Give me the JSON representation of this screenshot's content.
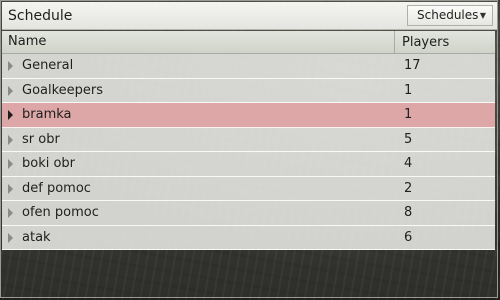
{
  "panel": {
    "title": "Schedule",
    "dropdown_label": "Schedules"
  },
  "table": {
    "columns": [
      "Name",
      "Players"
    ],
    "rows": [
      {
        "name": "General",
        "players": "17",
        "selected": false
      },
      {
        "name": "Goalkeepers",
        "players": "1",
        "selected": false
      },
      {
        "name": "bramka",
        "players": "1",
        "selected": true
      },
      {
        "name": "sr obr",
        "players": "5",
        "selected": false
      },
      {
        "name": "boki obr",
        "players": "4",
        "selected": false
      },
      {
        "name": "def pomoc",
        "players": "2",
        "selected": false
      },
      {
        "name": "ofen pomoc",
        "players": "8",
        "selected": false
      },
      {
        "name": "atak",
        "players": "6",
        "selected": false
      }
    ]
  },
  "icons": {
    "row_expand": "chevron-right-icon",
    "dropdown": "chevron-down-icon"
  },
  "colors": {
    "selected_row": "#dda7a7",
    "header_bg": "#d8dbd2",
    "row_bg": "#ecece9"
  }
}
